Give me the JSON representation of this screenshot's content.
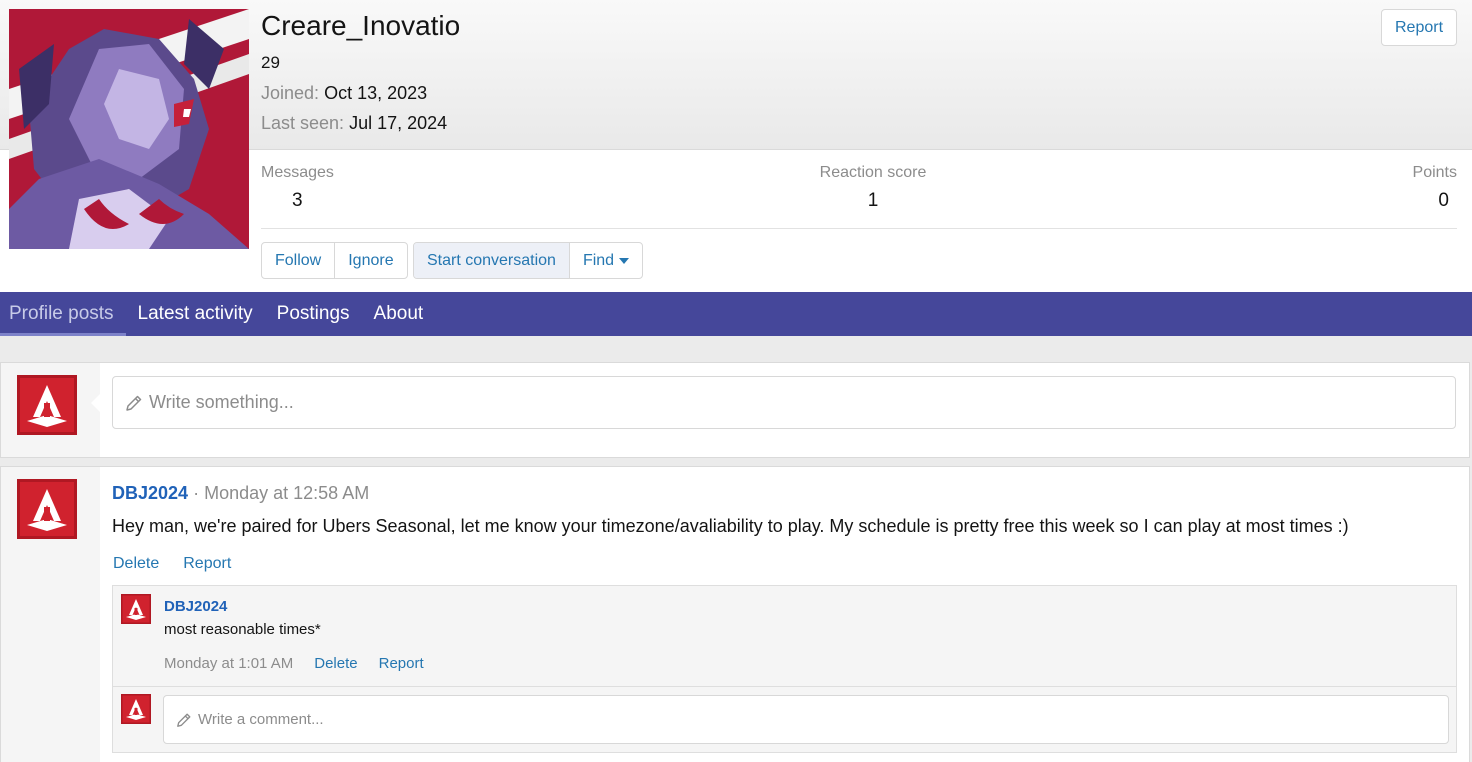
{
  "profile": {
    "username": "Creare_Inovatio",
    "user_title": "29",
    "joined_label": "Joined:",
    "joined_value": "Oct 13, 2023",
    "last_seen_label": "Last seen:",
    "last_seen_value": "Jul 17, 2024",
    "report_label": "Report",
    "stats": {
      "messages_label": "Messages",
      "messages_value": "3",
      "reaction_label": "Reaction score",
      "reaction_value": "1",
      "points_label": "Points",
      "points_value": "0"
    },
    "buttons": {
      "follow": "Follow",
      "ignore": "Ignore",
      "start_conversation": "Start conversation",
      "find": "Find"
    }
  },
  "tabs": [
    {
      "label": "Profile posts",
      "active": true
    },
    {
      "label": "Latest activity",
      "active": false
    },
    {
      "label": "Postings",
      "active": false
    },
    {
      "label": "About",
      "active": false
    }
  ],
  "compose": {
    "placeholder": "Write something..."
  },
  "post": {
    "author": "DBJ2024",
    "separator": "·",
    "date": "Monday at 12:58 AM",
    "body": "Hey man, we're paired for Ubers Seasonal, let me know your timezone/avaliability to play. My schedule is pretty free this week so I can play at most times :)",
    "delete_label": "Delete",
    "report_label": "Report",
    "comment": {
      "author": "DBJ2024",
      "text": "most reasonable times*",
      "time": "Monday at 1:01 AM",
      "delete_label": "Delete",
      "report_label": "Report"
    },
    "comment_placeholder": "Write a comment..."
  },
  "icons": {
    "pencil": "pencil-icon",
    "dropdown": "caret-down-icon"
  },
  "colors": {
    "tab_bar": "#45479a",
    "link": "#2577b1",
    "username_link": "#2062b8",
    "avatar_red": "#b01838"
  }
}
